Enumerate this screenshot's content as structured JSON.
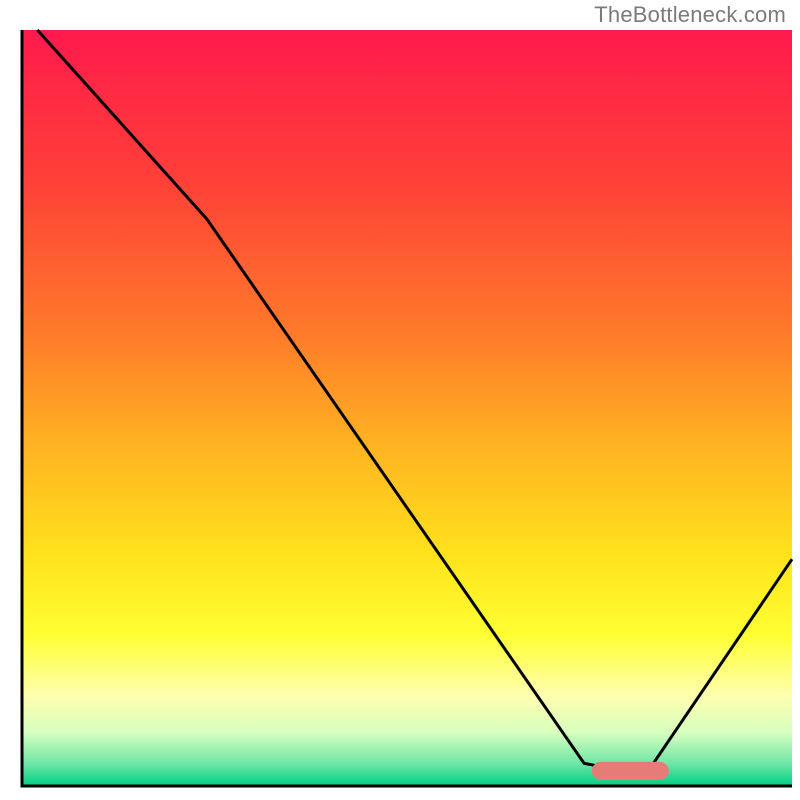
{
  "attribution": "TheBottleneck.com",
  "chart_data": {
    "type": "line",
    "title": "",
    "xlabel": "",
    "ylabel": "",
    "xlim": [
      0,
      100
    ],
    "ylim": [
      0,
      100
    ],
    "grid": false,
    "legend": false,
    "background_gradient_stops": [
      {
        "offset": 0.0,
        "color": "#ff1a4d"
      },
      {
        "offset": 0.2,
        "color": "#ff4038"
      },
      {
        "offset": 0.4,
        "color": "#ff7a2a"
      },
      {
        "offset": 0.55,
        "color": "#ffb321"
      },
      {
        "offset": 0.7,
        "color": "#ffe41c"
      },
      {
        "offset": 0.8,
        "color": "#ffff33"
      },
      {
        "offset": 0.88,
        "color": "#ffffb0"
      },
      {
        "offset": 0.93,
        "color": "#d6ffbf"
      },
      {
        "offset": 0.97,
        "color": "#6fe6a6"
      },
      {
        "offset": 1.0,
        "color": "#00d084"
      }
    ],
    "series": [
      {
        "name": "bottleneck-curve",
        "color": "#000000",
        "stroke_width": 3,
        "points": [
          {
            "x": 2,
            "y": 100
          },
          {
            "x": 24,
            "y": 75
          },
          {
            "x": 73,
            "y": 3
          },
          {
            "x": 78,
            "y": 2
          },
          {
            "x": 82,
            "y": 3
          },
          {
            "x": 100,
            "y": 30
          }
        ]
      }
    ],
    "marker": {
      "name": "optimal-range",
      "color": "#e77b78",
      "cx": 79,
      "cy": 2,
      "rx": 5,
      "ry": 1.2
    },
    "axes": {
      "color": "#000000",
      "stroke_width": 3
    }
  }
}
